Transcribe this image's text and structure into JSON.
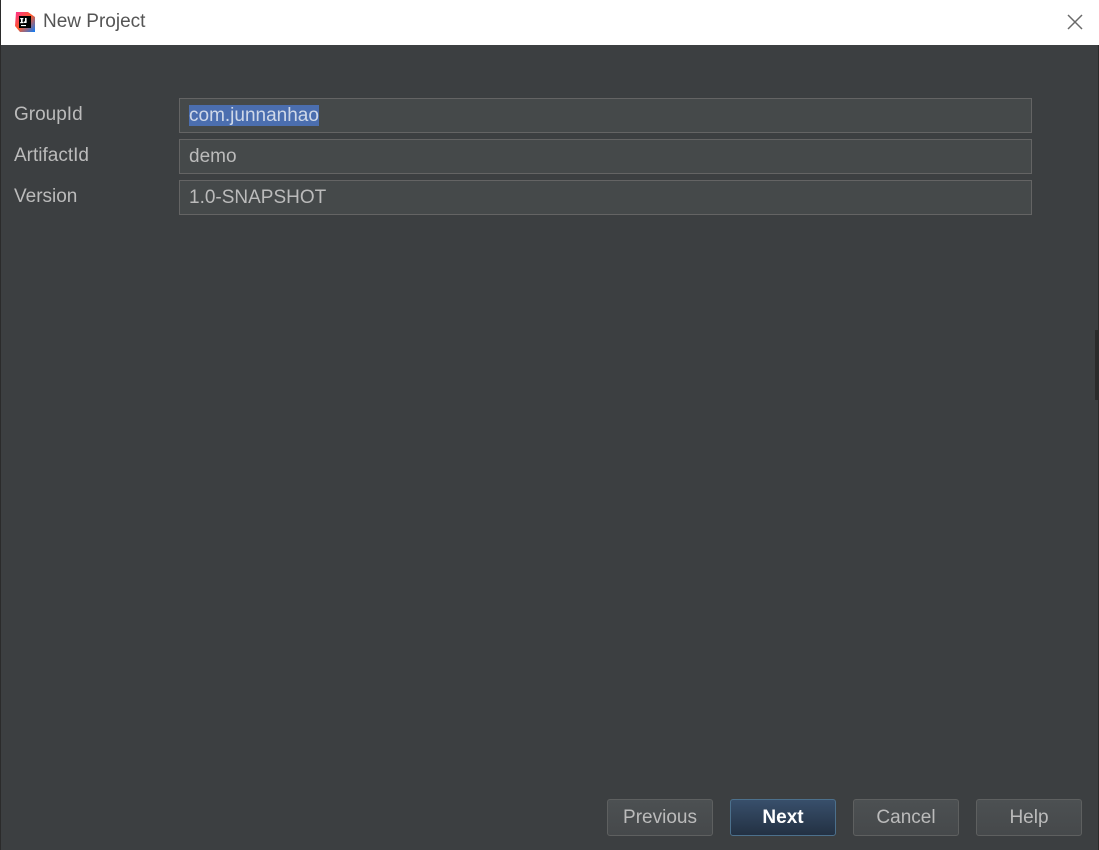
{
  "window": {
    "title": "New Project"
  },
  "form": {
    "fields": [
      {
        "label": "GroupId",
        "value": "com.junnanhao"
      },
      {
        "label": "ArtifactId",
        "value": "demo"
      },
      {
        "label": "Version",
        "value": "1.0-SNAPSHOT"
      }
    ]
  },
  "buttons": {
    "previous": "Previous",
    "next": "Next",
    "cancel": "Cancel",
    "help": "Help"
  },
  "icons": {
    "app": "intellij-idea-icon",
    "close": "close-icon"
  },
  "colors": {
    "background": "#3c3f41",
    "titlebar": "#ffffff",
    "input_background": "#45494a",
    "selection": "#4b6eaf",
    "default_button": "#2c3e55",
    "text": "#bbbbbb"
  }
}
